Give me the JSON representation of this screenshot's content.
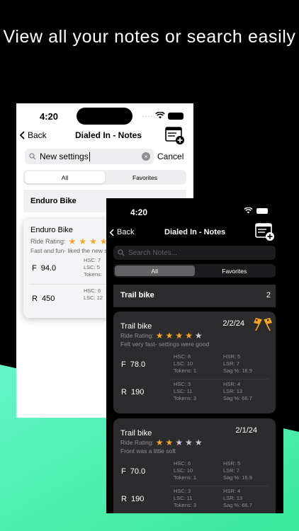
{
  "headline": "View all your notes or search easily",
  "colors": {
    "accent_green": "#3ff0a6",
    "star": "#f5a623",
    "dark_card": "#2c2c2e"
  },
  "light_screen": {
    "time": "4:20",
    "back_label": "Back",
    "title": "Dialed In - Notes",
    "search_value": "New settings",
    "cancel_label": "Cancel",
    "tabs": [
      "All",
      "Favorites"
    ],
    "group_name": "Enduro Bike",
    "card": {
      "name": "Enduro Bike",
      "rating_label": "Ride Rating:",
      "comment": "Fast and fun- liked the new s",
      "front": {
        "label": "F",
        "value": "94.0",
        "hsc": "HSC: 7",
        "lsc": "LSC: 5",
        "tokens": "Tokens: "
      },
      "rear": {
        "label": "R",
        "value": "450",
        "hsc": "HSC: 6",
        "lsc": "LSC: 12"
      }
    }
  },
  "dark_screen": {
    "time": "4:20",
    "back_label": "Back",
    "title": "Dialed In - Notes",
    "search_placeholder": "Search Notes...",
    "tabs": [
      "All",
      "Favorites"
    ],
    "group_name": "Trail bike",
    "group_count": "2",
    "notes": [
      {
        "name": "Trail bike",
        "date": "2/2/24",
        "rating_label": "Ride Rating:",
        "rating": 4,
        "comment": "Felt very fast- settings were good",
        "front": {
          "label": "F",
          "value": "78.0",
          "hsc": "HSC: 6",
          "lsc": "LSC: 10",
          "tokens": "Tokens: 1",
          "hsr": "HSR: 5",
          "lsr": "LSR: 7",
          "sag": "Sag %: 16.9"
        },
        "rear": {
          "label": "R",
          "value": "190",
          "hsc": "HSC: 3",
          "lsc": "LSC: 11",
          "tokens": "Tokens: 3",
          "hsr": "HSR: 4",
          "lsr": "LSR: 13",
          "sag": "Sag %: 66.7"
        }
      },
      {
        "name": "Trail bike",
        "date": "2/1/24",
        "rating_label": "Ride Rating:",
        "rating": 2,
        "comment": "Front was a little soft",
        "front": {
          "label": "F",
          "value": "70.0",
          "hsc": "HSC: 6",
          "lsc": "LSC: 10",
          "tokens": "Tokens: 1",
          "hsr": "HSR: 5",
          "lsr": "LSR: 7",
          "sag": "Sag %: 16.9"
        },
        "rear": {
          "label": "R",
          "value": "190",
          "hsc": "HSC: 3",
          "lsc": "LSC: 11",
          "tokens": "Tokens: 3",
          "hsr": "HSR: 4",
          "lsr": "LSR: 13",
          "sag": "Sag %: 66.7"
        }
      }
    ]
  }
}
